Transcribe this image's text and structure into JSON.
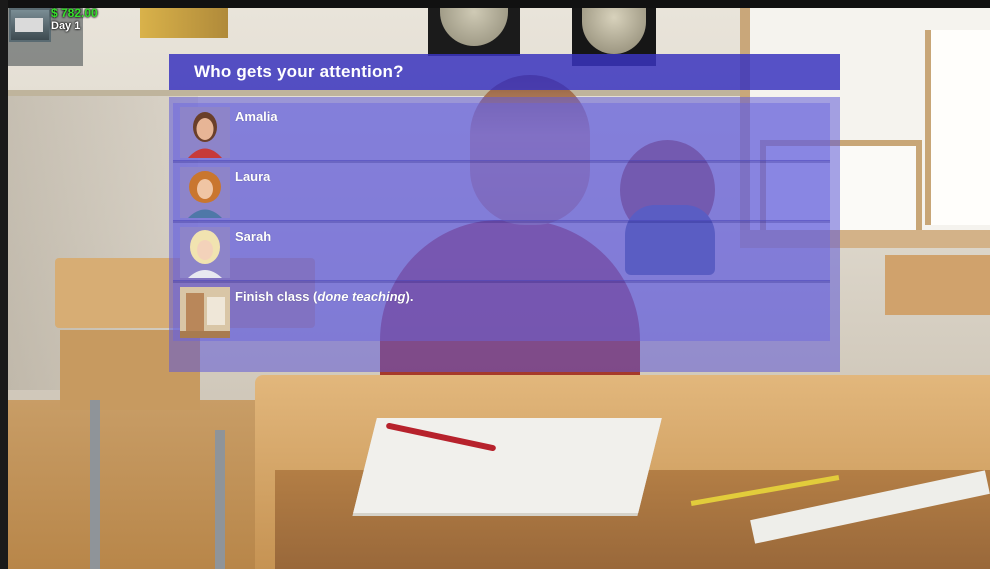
{
  "hud": {
    "money": "$ 782.00",
    "day": "Day 1",
    "avatar_icon": "character-avatar-icon"
  },
  "menu": {
    "title": "Who gets your attention?",
    "choices": [
      {
        "label": "Amalia",
        "portrait": "amalia-portrait"
      },
      {
        "label": "Laura",
        "portrait": "laura-portrait"
      },
      {
        "label": "Sarah",
        "portrait": "sarah-portrait"
      },
      {
        "label_prefix": "Finish class (",
        "label_italic": "done teaching",
        "label_suffix": ").",
        "portrait": "classroom-door-portrait"
      }
    ]
  },
  "colors": {
    "menu_title_bg": "#3a34be",
    "menu_panel_bg": "#5f5ad7",
    "money_text": "#35e02b",
    "text": "#ffffff"
  }
}
